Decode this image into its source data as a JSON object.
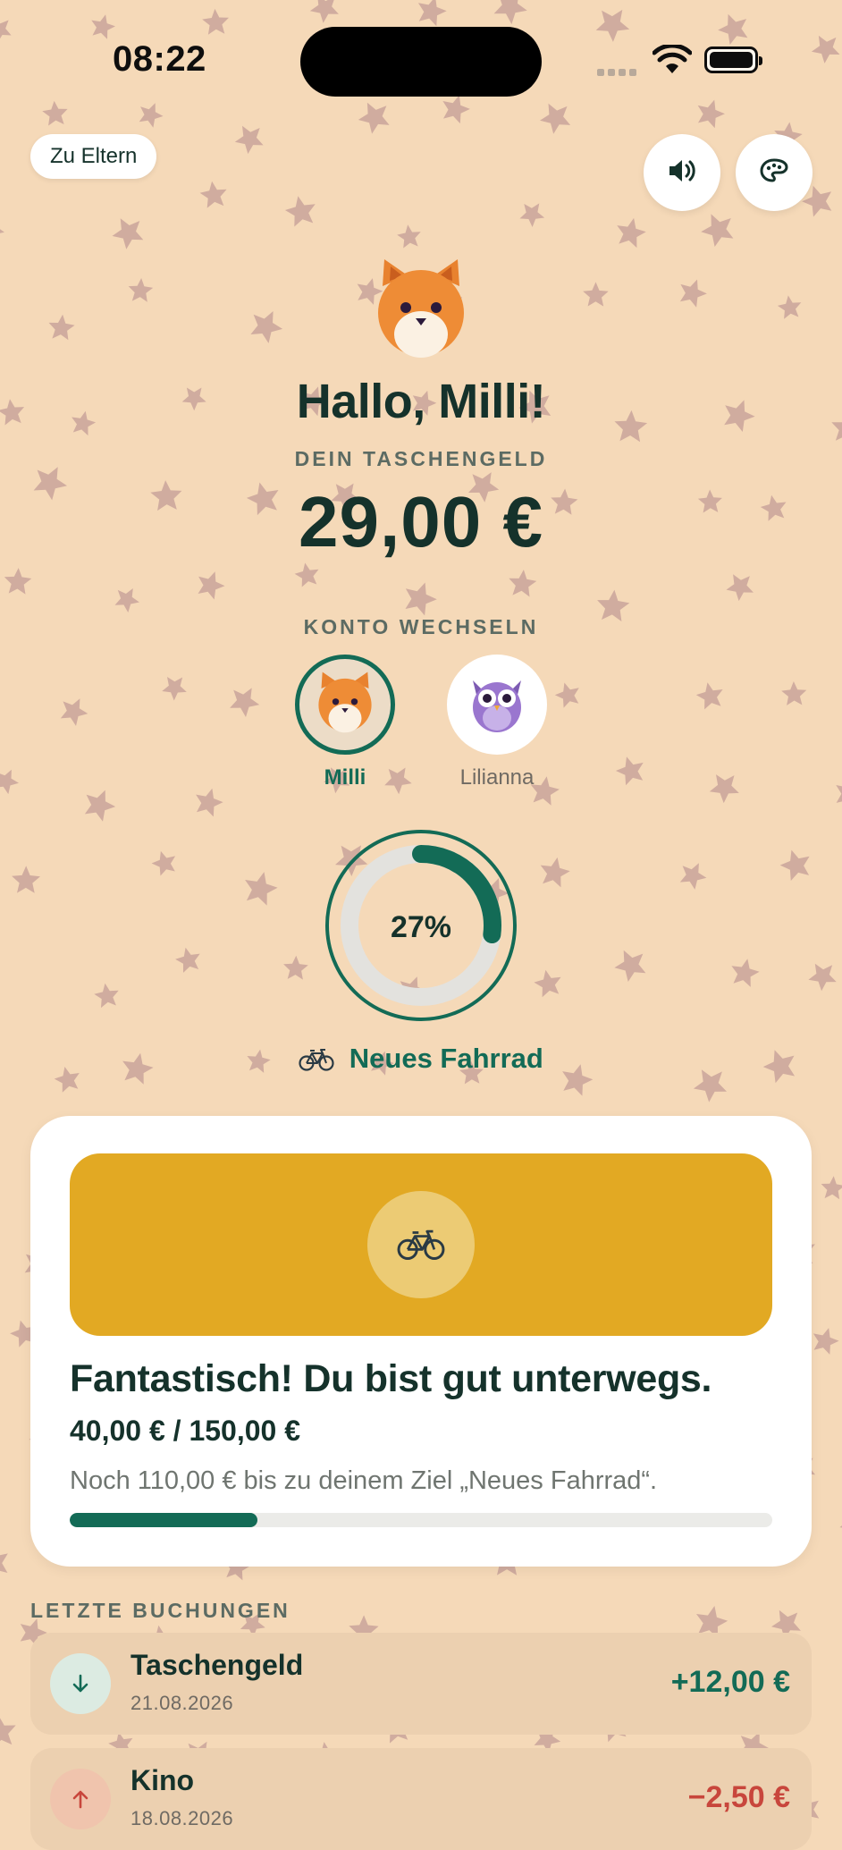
{
  "status_bar": {
    "time": "08:22"
  },
  "header": {
    "parents_button": "Zu Eltern",
    "greeting": "Hallo, Milli!",
    "balance_caption": "DEIN TASCHENGELD",
    "balance": "29,00 €"
  },
  "accounts": {
    "caption": "KONTO WECHSELN",
    "items": [
      {
        "name": "Milli",
        "avatar": "fox-icon",
        "selected": true
      },
      {
        "name": "Lilianna",
        "avatar": "owl-icon",
        "selected": false
      }
    ]
  },
  "goal": {
    "percent": 27,
    "percent_label": "27%",
    "emoji": "bicycle-icon",
    "title": "Neues Fahrrad"
  },
  "goal_card": {
    "headline": "Fantastisch! Du bist gut unterwegs.",
    "amount": "40,00 € / 150,00 €",
    "note": "Noch 110,00 € bis zu deinem Ziel „Neues Fahrrad“.",
    "progress_fraction": 0.267,
    "banner_color": "#e2a923"
  },
  "transactions": {
    "section_label": "LETZTE BUCHUNGEN",
    "items": [
      {
        "title": "Taschengeld",
        "date": "21.08.2026",
        "amount": "+12,00 €",
        "direction": "in"
      },
      {
        "title": "Kino",
        "date": "18.08.2026",
        "amount": "−2,50 €",
        "direction": "out"
      }
    ]
  },
  "colors": {
    "background": "#f5d9b8",
    "accent": "#136b56",
    "negative": "#c8463c",
    "star": "#c9a39a"
  }
}
